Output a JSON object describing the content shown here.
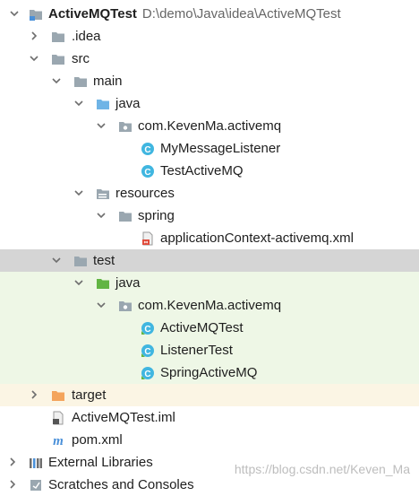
{
  "tree": {
    "project": {
      "name": "ActiveMQTest",
      "path": "D:\\demo\\Java\\idea\\ActiveMQTest"
    },
    "idea": ".idea",
    "src": "src",
    "main": "main",
    "main_java": "java",
    "main_pkg": "com.KevenMa.activemq",
    "class_listener": "MyMessageListener",
    "class_test": "TestActiveMQ",
    "resources": "resources",
    "spring": "spring",
    "xml": "applicationContext-activemq.xml",
    "test": "test",
    "test_java": "java",
    "test_pkg": "com.KevenMa.activemq",
    "class_activemqtest": "ActiveMQTest",
    "class_listenertest": "ListenerTest",
    "class_springactivemq": "SpringActiveMQ",
    "target": "target",
    "iml": "ActiveMQTest.iml",
    "pom": "pom.xml",
    "ext_libs": "External Libraries",
    "scratches": "Scratches and Consoles"
  },
  "watermark": "https://blog.csdn.net/Keven_Ma",
  "colors": {
    "folder_gray": "#9aa7b0",
    "folder_blue": "#6fb4e6",
    "folder_green": "#62b543",
    "folder_orange": "#f4a45c",
    "class_blue": "#40b6e0",
    "selection": "#d5d5d5"
  }
}
